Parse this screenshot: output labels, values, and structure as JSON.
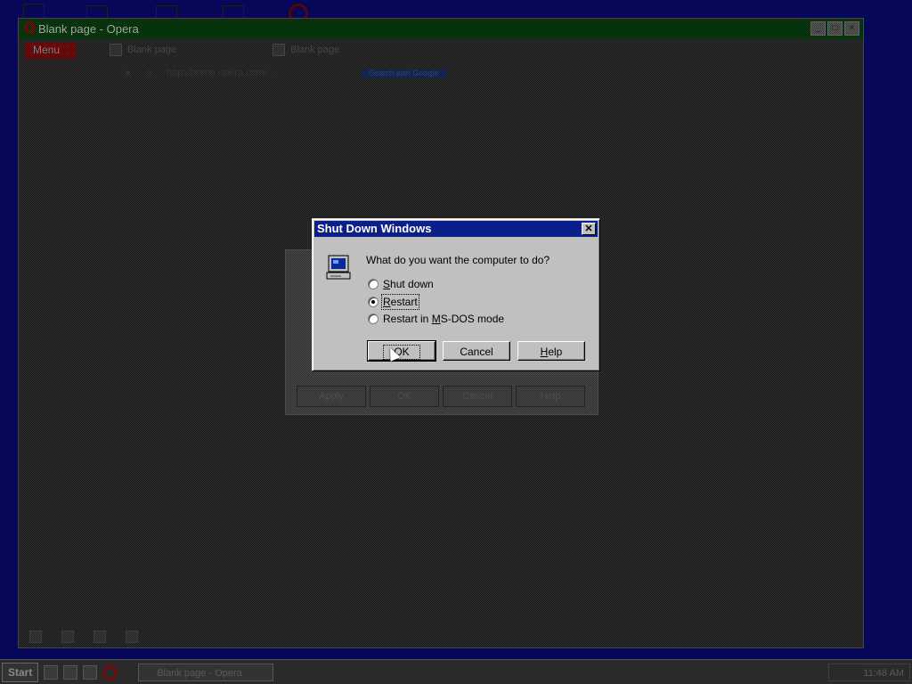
{
  "browser": {
    "title": "Blank page - Opera",
    "menu_label": "Menu",
    "tabs": [
      "Blank page",
      "Blank page"
    ],
    "address": "http://home.opera.com/...",
    "search_placeholder": "Search with Google"
  },
  "ghost_dialog": {
    "buttons": [
      "Apply",
      "OK",
      "Cancel",
      "Help"
    ]
  },
  "dialog": {
    "title": "Shut Down Windows",
    "close_glyph": "✕",
    "question": "What do you want the computer to do?",
    "options": [
      {
        "pre": "",
        "accel": "S",
        "post": "hut down",
        "selected": false
      },
      {
        "pre": "",
        "accel": "R",
        "post": "estart",
        "selected": true
      },
      {
        "pre": "Restart in ",
        "accel": "M",
        "post": "S-DOS mode",
        "selected": false
      }
    ],
    "buttons": {
      "ok": "OK",
      "cancel": "Cancel",
      "help_accel": "H",
      "help_rest": "elp"
    }
  },
  "taskbar": {
    "start_label": "Start",
    "task_label": "Blank page - Opera",
    "clock": "11:48 AM"
  },
  "colors": {
    "desktop": "#0a0a5c",
    "dialog_title": "#0a1f8a",
    "dialog_face": "#c0c0c0"
  }
}
